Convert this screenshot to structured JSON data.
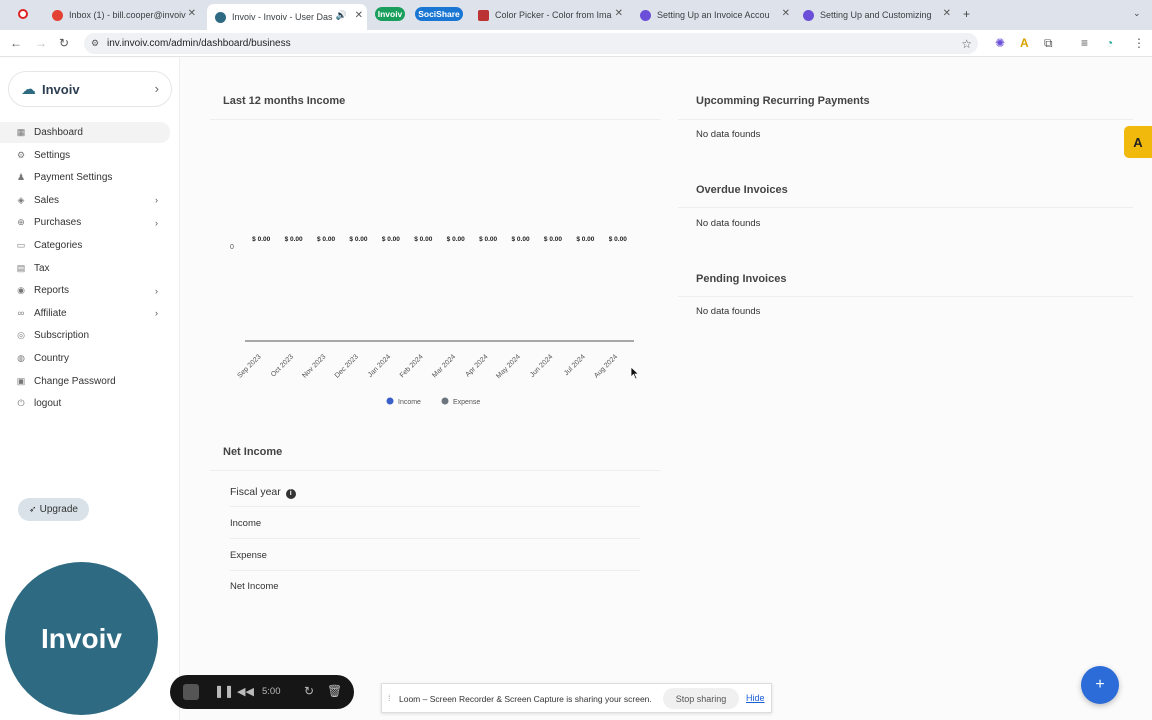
{
  "browser": {
    "tabs": [
      {
        "title": "Inbox (1) - bill.cooper@invoiv",
        "active": false
      },
      {
        "title": "Invoiv - Invoiv - User Das",
        "active": true
      },
      {
        "title": "Color Picker - Color from Ima",
        "active": false
      },
      {
        "title": "Setting Up an Invoice Accou",
        "active": false
      },
      {
        "title": "Setting Up and Customizing",
        "active": false
      }
    ],
    "group_pills": [
      "Invoiv",
      "SociShare"
    ],
    "url": "inv.invoiv.com/admin/dashboard/business"
  },
  "sidebar": {
    "brand": "Invoiv",
    "items": [
      {
        "label": "Dashboard",
        "icon": "grid-icon",
        "active": true,
        "has_arrow": false
      },
      {
        "label": "Settings",
        "icon": "gear-icon",
        "active": false,
        "has_arrow": false
      },
      {
        "label": "Payment Settings",
        "icon": "person-icon",
        "active": false,
        "has_arrow": false
      },
      {
        "label": "Sales",
        "icon": "tag-icon",
        "active": false,
        "has_arrow": true
      },
      {
        "label": "Purchases",
        "icon": "cart-icon",
        "active": false,
        "has_arrow": true
      },
      {
        "label": "Categories",
        "icon": "folder-icon",
        "active": false,
        "has_arrow": false
      },
      {
        "label": "Tax",
        "icon": "receipt-icon",
        "active": false,
        "has_arrow": false
      },
      {
        "label": "Reports",
        "icon": "chart-icon",
        "active": false,
        "has_arrow": true
      },
      {
        "label": "Affiliate",
        "icon": "link-icon",
        "active": false,
        "has_arrow": true
      },
      {
        "label": "Subscription",
        "icon": "repeat-icon",
        "active": false,
        "has_arrow": false
      },
      {
        "label": "Country",
        "icon": "globe-icon",
        "active": false,
        "has_arrow": false
      },
      {
        "label": "Change Password",
        "icon": "lock-icon",
        "active": false,
        "has_arrow": false
      },
      {
        "label": "logout",
        "icon": "logout-icon",
        "active": false,
        "has_arrow": false
      }
    ],
    "upgrade_label": "Upgrade"
  },
  "income_card": {
    "title": "Last 12 months Income"
  },
  "chart_data": {
    "type": "bar",
    "title": "Last 12 months Income",
    "categories": [
      "Sep 2023",
      "Oct 2023",
      "Nov 2023",
      "Dec 2023",
      "Jan 2024",
      "Feb 2024",
      "Mar 2024",
      "Apr 2024",
      "May 2024",
      "Jun 2024",
      "Jul 2024",
      "Aug 2024"
    ],
    "series": [
      {
        "name": "Income",
        "values": [
          0,
          0,
          0,
          0,
          0,
          0,
          0,
          0,
          0,
          0,
          0,
          0
        ],
        "color": "#3b5fc9"
      },
      {
        "name": "Expense",
        "values": [
          0,
          0,
          0,
          0,
          0,
          0,
          0,
          0,
          0,
          0,
          0,
          0
        ],
        "color": "#6c757d"
      }
    ],
    "data_labels": [
      "$ 0.00",
      "$ 0.00",
      "$ 0.00",
      "$ 0.00",
      "$ 0.00",
      "$ 0.00",
      "$ 0.00",
      "$ 0.00",
      "$ 0.00",
      "$ 0.00",
      "$ 0.00",
      "$ 0.00"
    ],
    "y_ticks": [
      "0"
    ],
    "legend_position": "bottom",
    "grid": false
  },
  "right_panels": [
    {
      "title": "Upcomming Recurring Payments",
      "empty_text": "No data founds"
    },
    {
      "title": "Overdue Invoices",
      "empty_text": "No data founds"
    },
    {
      "title": "Pending Invoices",
      "empty_text": "No data founds"
    }
  ],
  "net_income": {
    "title": "Net Income",
    "fiscal_label": "Fiscal year",
    "rows": [
      "Income",
      "Expense",
      "Net Income"
    ]
  },
  "recorder": {
    "time": "5:00"
  },
  "loom": {
    "message": "Loom – Screen Recorder & Screen Capture is sharing your screen.",
    "stop_label": "Stop sharing",
    "hide_label": "Hide"
  },
  "camera_overlay_text": "Invoiv"
}
